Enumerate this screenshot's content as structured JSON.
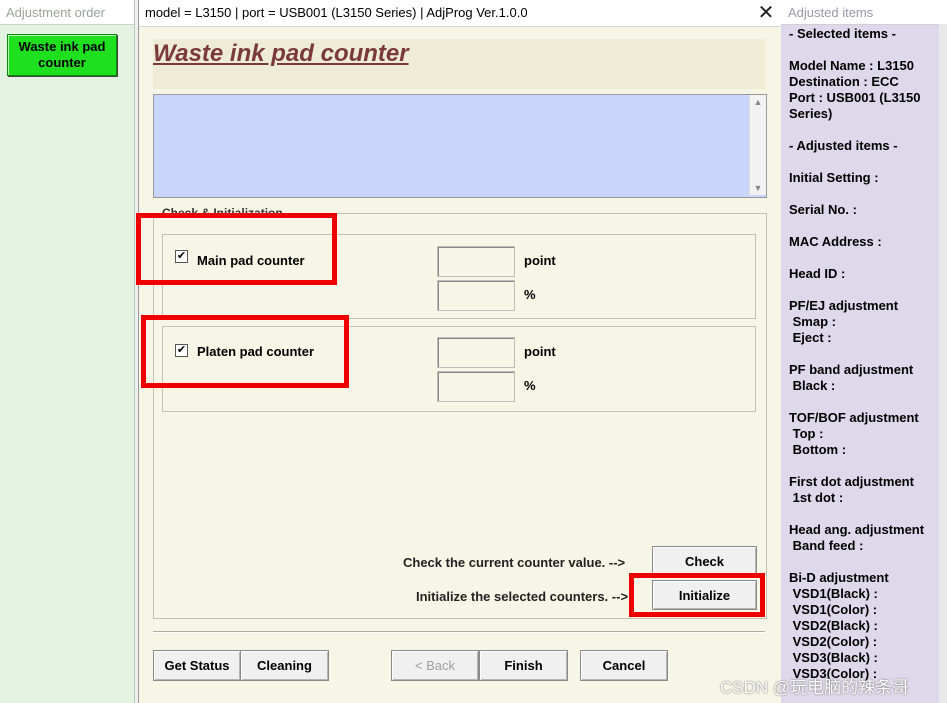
{
  "left_panel": {
    "title": "Adjustment order",
    "active_item_label": "Waste ink pad\ncounter",
    "active_item_color": "#1fe01f"
  },
  "window": {
    "title": "model = L3150 | port = USB001 (L3150 Series) | AdjProg Ver.1.0.0",
    "close_glyph": "✕"
  },
  "page": {
    "heading": "Waste ink pad counter",
    "group_legend": "Check & Initialization",
    "counters": [
      {
        "label": "Main pad counter",
        "checked": true,
        "check_glyph": "✔",
        "unit_point": "point",
        "unit_percent": "%"
      },
      {
        "label": "Platen pad counter",
        "checked": true,
        "check_glyph": "✔",
        "unit_point": "point",
        "unit_percent": "%"
      }
    ],
    "check_prompt": "Check the current counter value. -->",
    "check_button": "Check",
    "init_prompt": "Initialize the selected counters. -->",
    "init_button": "Initialize",
    "highlight_color": "#ee0000"
  },
  "footer": {
    "get_status": "Get Status",
    "cleaning": "Cleaning",
    "back": "< Back",
    "finish": "Finish",
    "cancel": "Cancel"
  },
  "right_panel": {
    "title": "Adjusted items",
    "lines": [
      "- Selected items -",
      "",
      "Model Name : L3150",
      "Destination : ECC",
      "Port : USB001 (L3150",
      "Series)",
      "",
      "- Adjusted items -",
      "",
      "Initial Setting :",
      "",
      "Serial No. :",
      "",
      "MAC Address :",
      "",
      "Head ID :",
      "",
      "PF/EJ adjustment",
      " Smap :",
      " Eject :",
      "",
      "PF band adjustment",
      " Black :",
      "",
      "TOF/BOF adjustment",
      " Top :",
      " Bottom :",
      "",
      "First dot adjustment",
      " 1st dot :",
      "",
      "Head ang. adjustment",
      " Band feed :",
      "",
      "Bi-D adjustment",
      " VSD1(Black) :",
      " VSD1(Color) :",
      " VSD2(Black) :",
      " VSD2(Color) :",
      " VSD3(Black) :",
      " VSD3(Color) :"
    ]
  },
  "watermark": "CSDN @玩电脑的辣条哥"
}
